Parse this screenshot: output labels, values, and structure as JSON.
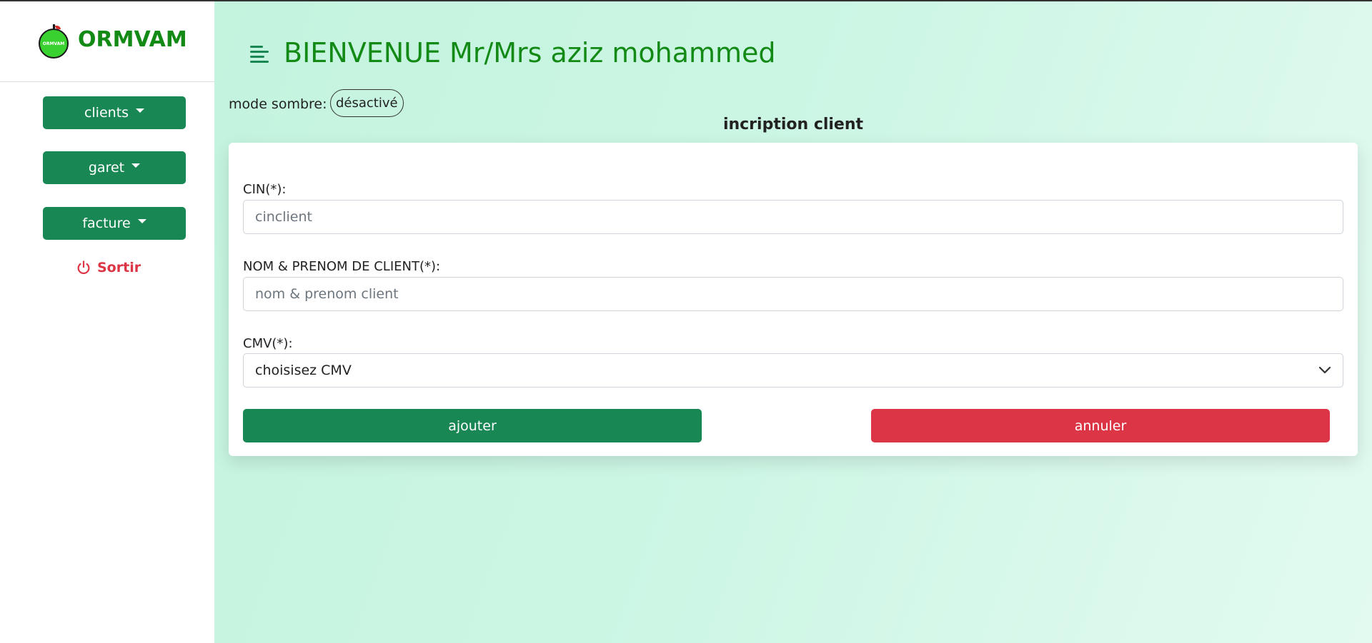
{
  "brand": {
    "logo_text": "ORMVAM",
    "name": "ORMVAM"
  },
  "sidebar": {
    "items": [
      {
        "label": "clients"
      },
      {
        "label": "garet"
      },
      {
        "label": "facture"
      }
    ],
    "logout_label": "Sortir"
  },
  "header": {
    "title": "BIENVENUE Mr/Mrs aziz mohammed"
  },
  "dark_mode": {
    "label": "mode sombre:",
    "state": "désactivé"
  },
  "form": {
    "title": "incription client",
    "fields": [
      {
        "label": "CIN(*):",
        "placeholder": "cinclient",
        "value": ""
      },
      {
        "label": "NOM & PRENOM DE CLIENT(*):",
        "placeholder": "nom & prenom client",
        "value": ""
      }
    ],
    "cmv": {
      "label": "CMV(*):",
      "selected": "choisisez CMV"
    },
    "submit_label": "ajouter",
    "cancel_label": "annuler"
  },
  "colors": {
    "primary": "#198754",
    "danger": "#dc3545",
    "brand_green": "#138a15"
  }
}
